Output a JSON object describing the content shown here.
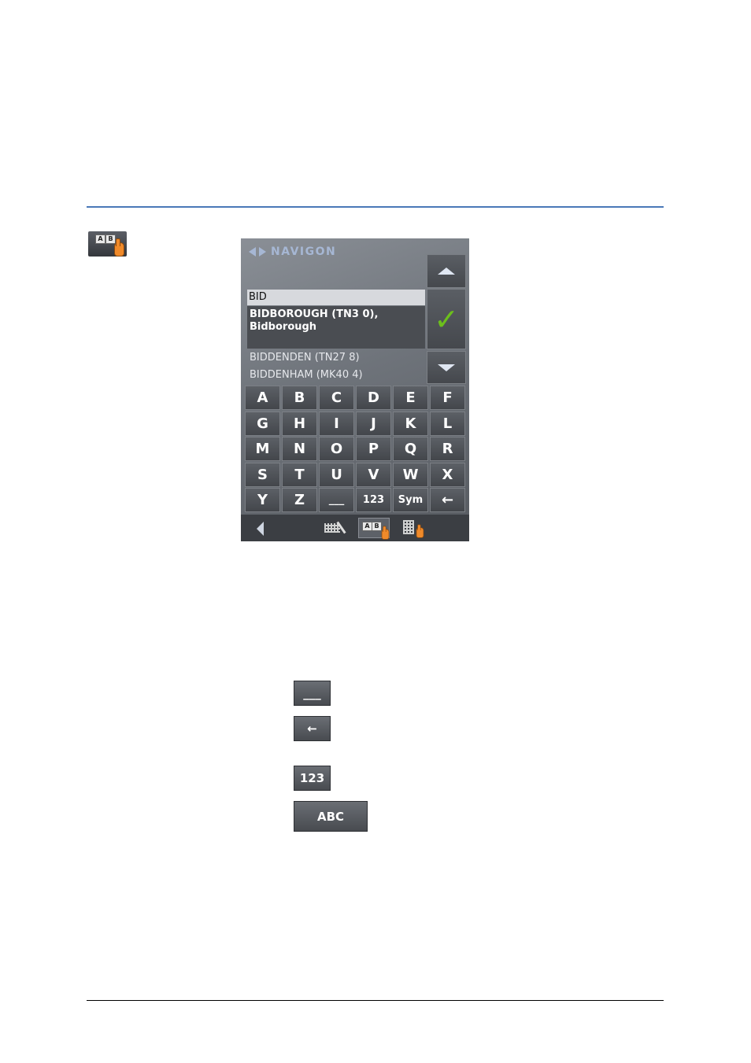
{
  "margin_icon": {
    "name": "abc-keyboard-icon",
    "glyph_a": "A",
    "glyph_b": "B"
  },
  "device": {
    "logo_text": "NAVIGON",
    "input_value": "BID",
    "selected_item": {
      "line1": "BIDBOROUGH (TN3 0),",
      "line2": "Bidborough"
    },
    "list_items": [
      "BIDDENDEN (TN27 8)",
      "BIDDENHAM (MK40 4)"
    ],
    "keys": [
      [
        "A",
        "B",
        "C",
        "D",
        "E",
        "F"
      ],
      [
        "G",
        "H",
        "I",
        "J",
        "K",
        "L"
      ],
      [
        "M",
        "N",
        "O",
        "P",
        "Q",
        "R"
      ],
      [
        "S",
        "T",
        "U",
        "V",
        "W",
        "X"
      ],
      [
        "Y",
        "Z",
        "___",
        "123",
        "Sym",
        "←"
      ]
    ],
    "bottom_bar": {
      "mode_active_a": "A",
      "mode_active_b": "B"
    }
  },
  "legend": {
    "space": "___",
    "backspace": "←",
    "numbers": "123",
    "letters": "ABC"
  }
}
